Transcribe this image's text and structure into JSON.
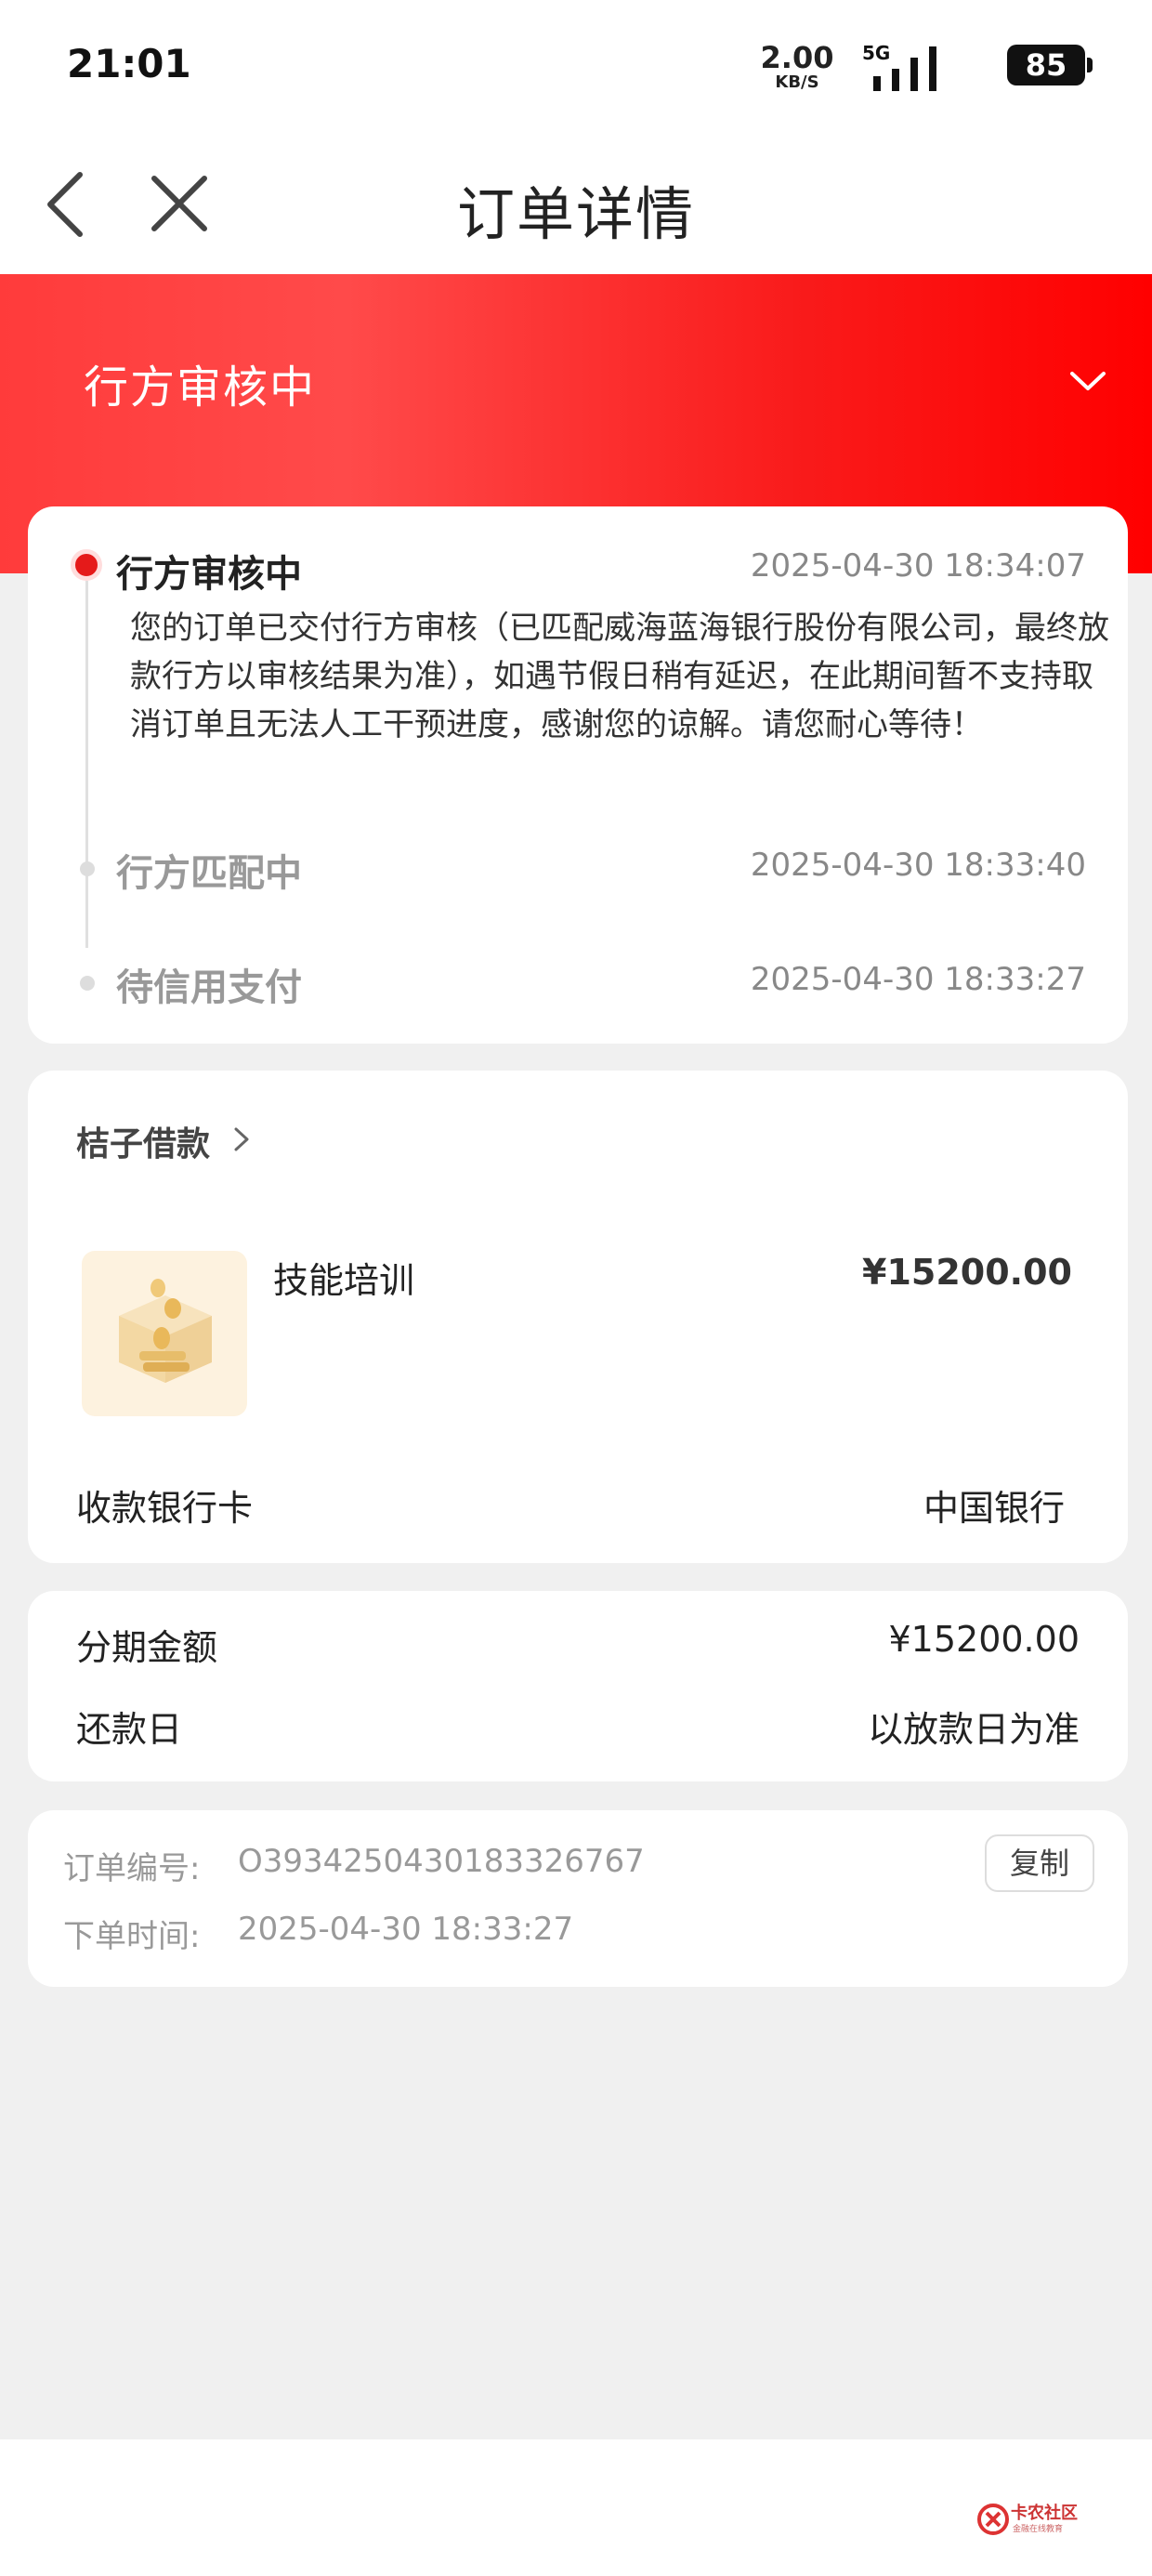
{
  "status_bar": {
    "time": "21:01",
    "net_speed_value": "2.00",
    "net_speed_unit": "KB/S",
    "network": "5G",
    "battery": "85"
  },
  "nav": {
    "title": "订单详情",
    "back_icon": "back-chevron-icon",
    "close_icon": "close-icon"
  },
  "banner": {
    "title": "行方审核中",
    "toggle_icon": "chevron-down-icon"
  },
  "timeline": [
    {
      "title": "行方审核中",
      "time": "2025-04-30 18:34:07",
      "description": "您的订单已交付行方审核（已匹配威海蓝海银行股份有限公司，最终放款行方以审核结果为准），如遇节假日稍有延迟，在此期间暂不支持取消订单且无法人工干预进度，感谢您的谅解。请您耐心等待！"
    },
    {
      "title": "行方匹配中",
      "time": "2025-04-30 18:33:40"
    },
    {
      "title": "待信用支付",
      "time": "2025-04-30 18:33:27"
    }
  ],
  "merchant": {
    "name": "桔子借款",
    "item_name": "技能培训",
    "item_price": "¥15200.00",
    "bank_label": "收款银行卡",
    "bank_value": "中国银行"
  },
  "installment": {
    "amount_label": "分期金额",
    "amount_value": "¥15200.00",
    "repay_label": "还款日",
    "repay_value": "以放款日为准"
  },
  "order": {
    "number_label": "订单编号:",
    "number_value": "O3934250430183326767",
    "time_label": "下单时间:",
    "time_value": "2025-04-30 18:33:27",
    "copy_label": "复制"
  },
  "watermark": {
    "name": "卡农社区",
    "sub": "金融在线教育"
  },
  "colors": {
    "accent": "#e51a1a",
    "banner_start": "#ff3b3b",
    "banner_end": "#ff0000",
    "background": "#f0f0f0"
  }
}
